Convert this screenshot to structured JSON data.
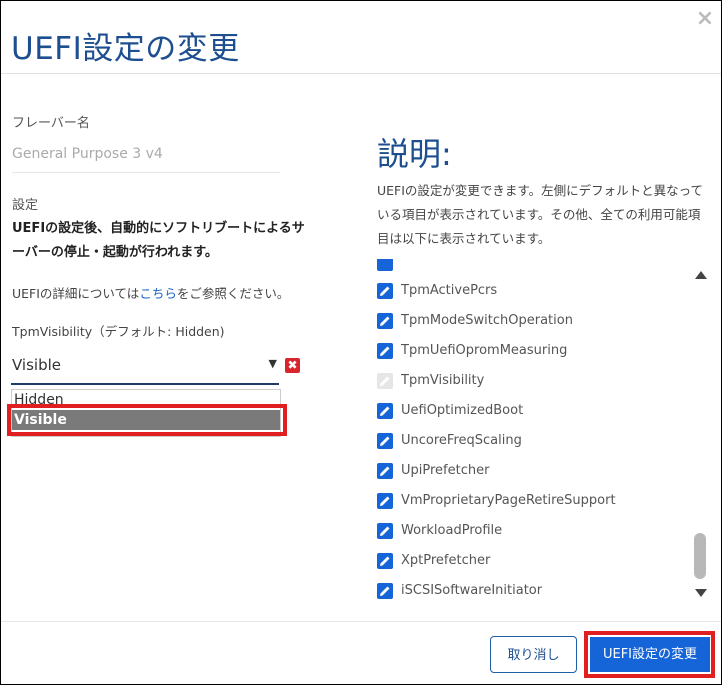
{
  "dialog": {
    "title": "UEFI設定の変更",
    "close_icon": "close-icon"
  },
  "left": {
    "flavor_label": "フレーバー名",
    "flavor_value": "General Purpose 3 v4",
    "settings_label": "設定",
    "warning": "UEFIの設定後、自動的にソフトリブートによるサーバーの停止・起動が行われます。",
    "detail_prefix": "UEFIの詳細については",
    "detail_link": "こちら",
    "detail_suffix": "をご参照ください。",
    "param_label": "TpmVisibility（デフォルト: Hidden)",
    "select": {
      "value": "Visible",
      "options": [
        "Hidden",
        "Visible"
      ],
      "highlighted_option": "Visible"
    }
  },
  "right": {
    "desc_title": "説明:",
    "desc_text": "UEFIの設定が変更できます。左側にデフォルトと異なっている項目が表示されています。その他、全ての利用可能項目は以下に表示されています。",
    "items": [
      {
        "label": "TpmActivePcrs",
        "enabled": true
      },
      {
        "label": "TpmModeSwitchOperation",
        "enabled": true
      },
      {
        "label": "TpmUefiOpromMeasuring",
        "enabled": true
      },
      {
        "label": "TpmVisibility",
        "enabled": false
      },
      {
        "label": "UefiOptimizedBoot",
        "enabled": true
      },
      {
        "label": "UncoreFreqScaling",
        "enabled": true
      },
      {
        "label": "UpiPrefetcher",
        "enabled": true
      },
      {
        "label": "VmProprietaryPageRetireSupport",
        "enabled": true
      },
      {
        "label": "WorkloadProfile",
        "enabled": true
      },
      {
        "label": "XptPrefetcher",
        "enabled": true
      },
      {
        "label": "iSCSISoftwareInitiator",
        "enabled": true
      }
    ]
  },
  "footer": {
    "cancel_label": "取り消し",
    "submit_label": "UEFI設定の変更"
  },
  "colors": {
    "accent": "#1565d8",
    "title": "#1d4e8f",
    "highlight": "#e02020"
  }
}
